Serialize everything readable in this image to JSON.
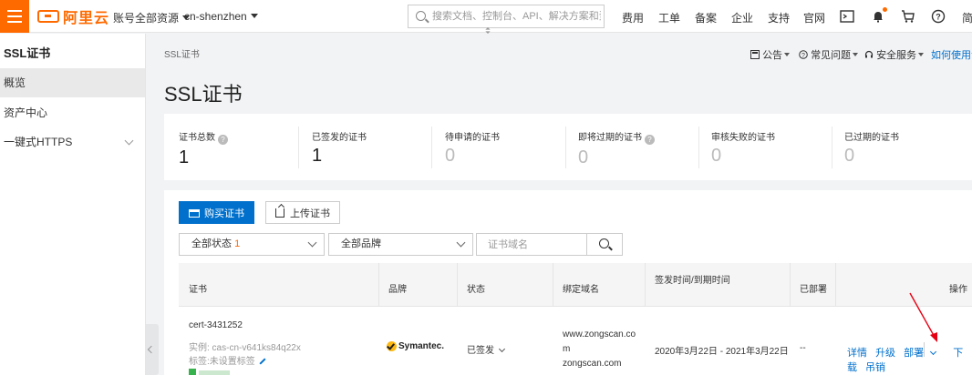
{
  "topbar": {
    "logo_text": "阿里云",
    "account_selector": "账号全部资源",
    "region_selector": "cn-shenzhen",
    "search_placeholder": "搜索文档、控制台、API、解决方案和资源",
    "links": [
      "费用",
      "工单",
      "备案",
      "企业",
      "支持",
      "官网"
    ],
    "last_link": "简"
  },
  "sidebar": {
    "title": "SSL证书",
    "items": [
      {
        "label": "概览",
        "active": true
      },
      {
        "label": "资产中心",
        "active": false
      },
      {
        "label": "一键式HTTPS",
        "active": false
      }
    ]
  },
  "main": {
    "breadcrumb": "SSL证书",
    "title": "SSL证书",
    "right_links": {
      "announcement": "公告",
      "faq": "常见问题",
      "security": "安全服务",
      "howto": "如何使用证"
    }
  },
  "stats": [
    {
      "label": "证书总数",
      "value": "1",
      "help": true
    },
    {
      "label": "已签发的证书",
      "value": "1",
      "help": false
    },
    {
      "label": "待申请的证书",
      "value": "0",
      "help": false
    },
    {
      "label": "即将过期的证书",
      "value": "0",
      "help": true
    },
    {
      "label": "审核失败的证书",
      "value": "0",
      "help": false
    },
    {
      "label": "已过期的证书",
      "value": "0",
      "help": false
    }
  ],
  "toolbar": {
    "buy_label": "购买证书",
    "upload_label": "上传证书",
    "status_filter": "全部状态",
    "status_count": "1",
    "brand_filter": "全部品牌",
    "domain_placeholder": "证书域名"
  },
  "table": {
    "headers": {
      "cert": "证书",
      "brand": "品牌",
      "status": "状态",
      "domain": "绑定域名",
      "time": "签发时间/到期时间",
      "deployed": "已部署",
      "ops": "操作"
    },
    "row": {
      "cert_name": "cert-3431252",
      "instance": "实例: cas-cn-v641ks84q22x",
      "tag": "标签:未设置标签",
      "brand": "Symantec.",
      "status": "已签发",
      "domain_line1": "www.zongscan.co",
      "domain_line2": "m",
      "domain_line3": "zongscan.com",
      "time": "2020年3月22日 - 2021年3月22日",
      "deployed": "--",
      "ops": [
        "详情",
        "升级",
        "部署",
        "下载",
        "吊销"
      ]
    }
  },
  "colors": {
    "brand_orange": "#ff6a00",
    "link_blue": "#0070cc",
    "annotation_red": "#e60012"
  }
}
